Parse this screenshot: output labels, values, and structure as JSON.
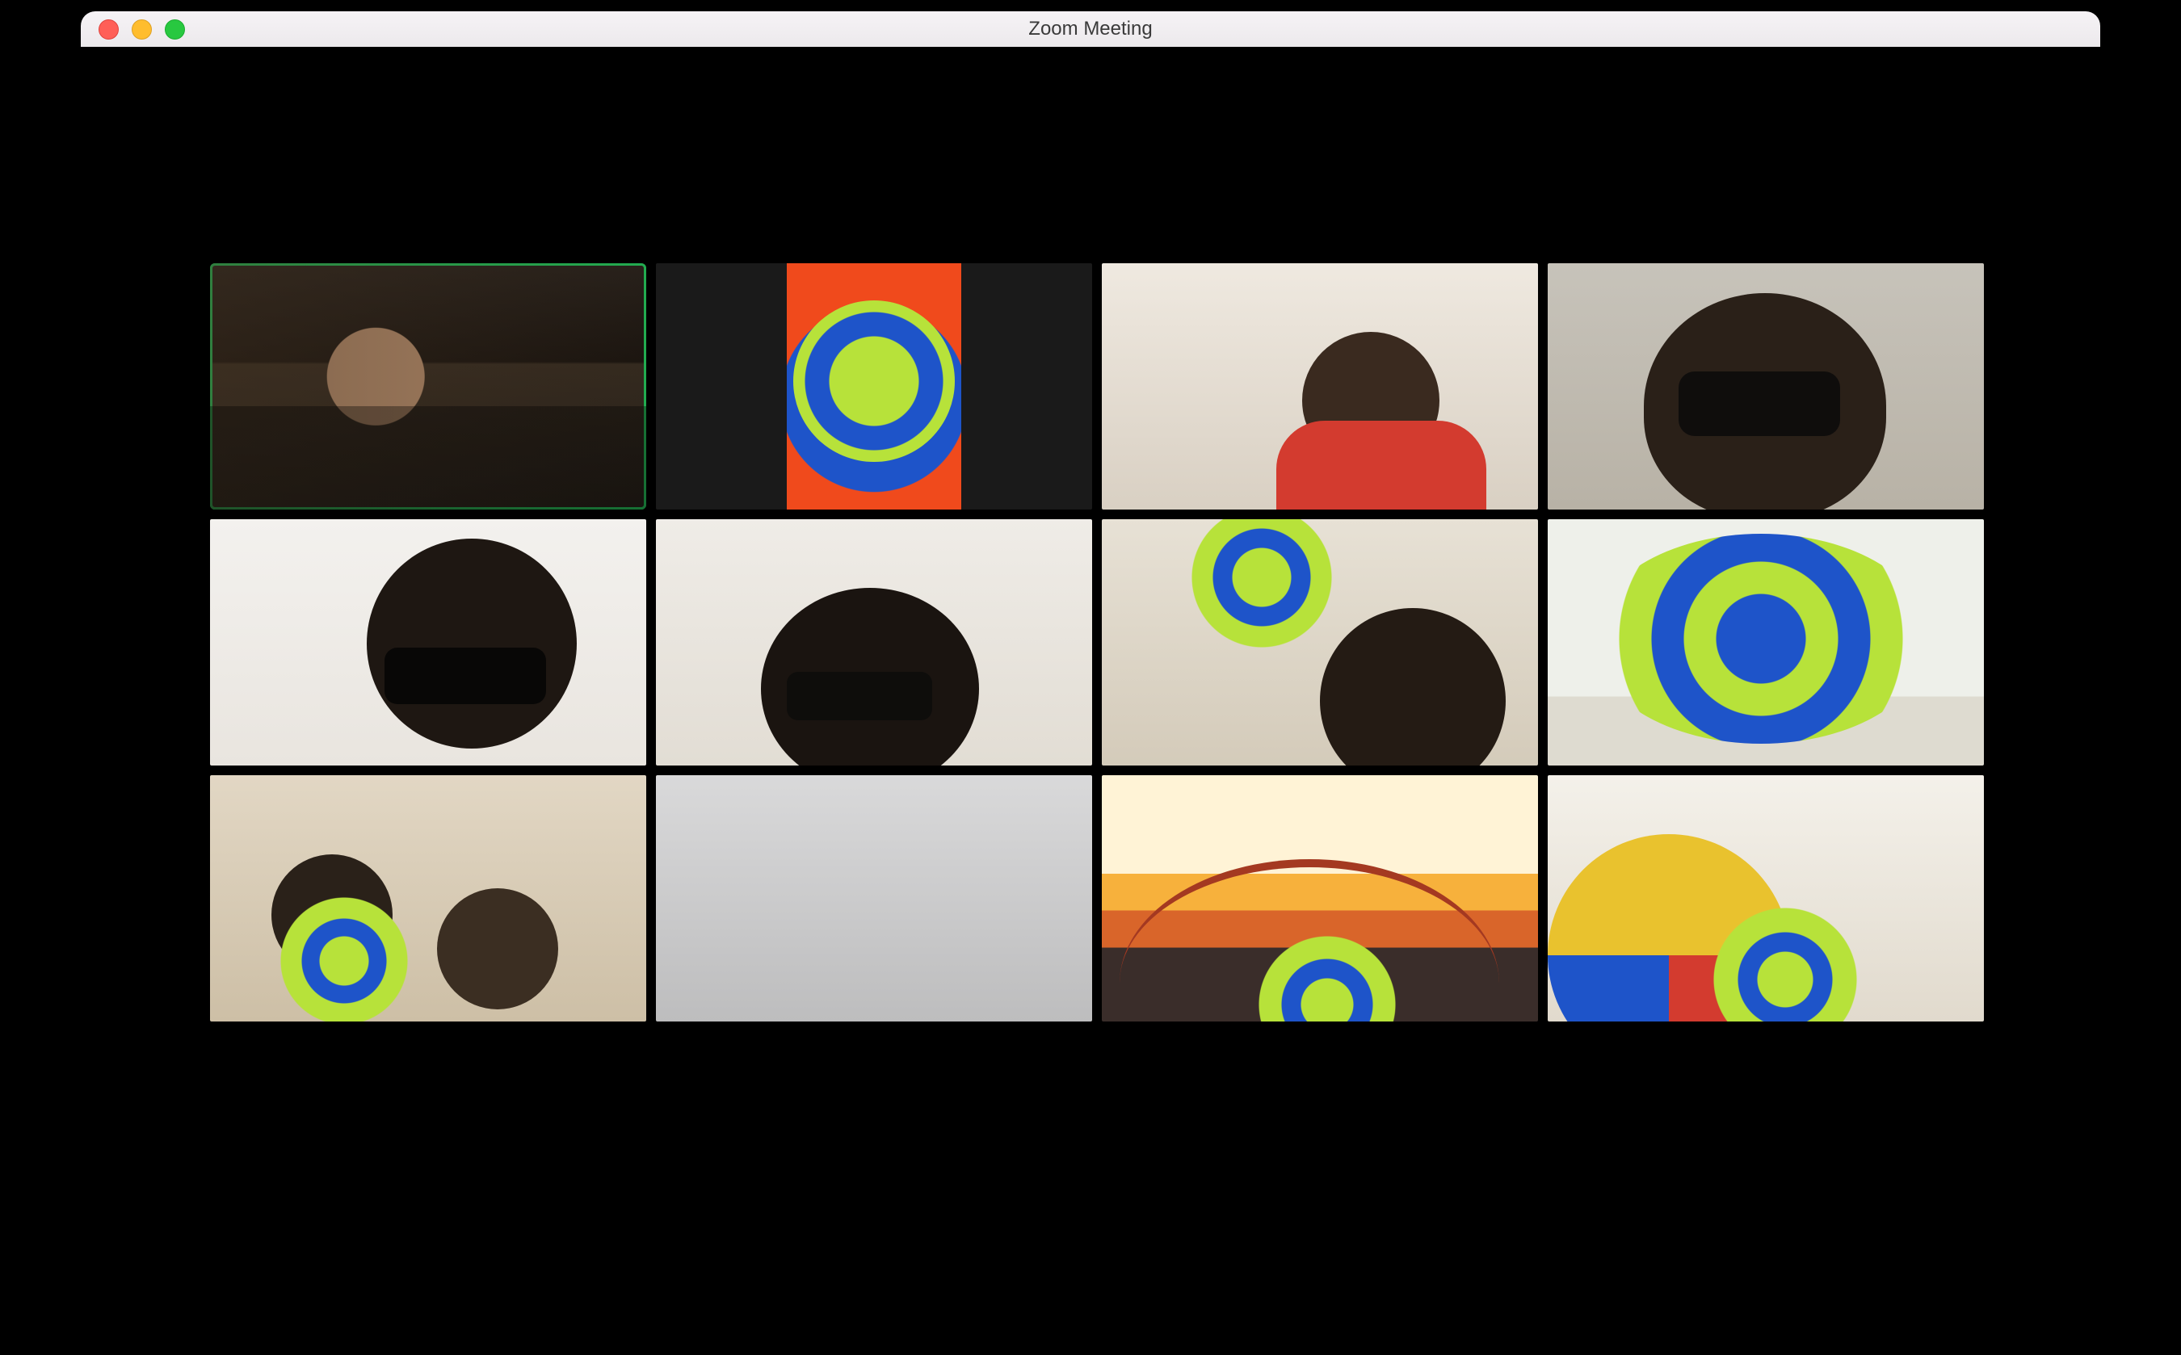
{
  "window": {
    "title": "Zoom Meeting"
  },
  "grid": {
    "columns": 4,
    "rows": 3,
    "activeSpeakerIndex": 0,
    "tiles": [
      {
        "desc": "participant-1-speaking",
        "speaking": true
      },
      {
        "desc": "participant-2"
      },
      {
        "desc": "participant-3"
      },
      {
        "desc": "participant-4"
      },
      {
        "desc": "participant-5"
      },
      {
        "desc": "participant-6"
      },
      {
        "desc": "participant-7"
      },
      {
        "desc": "participant-8"
      },
      {
        "desc": "participant-9"
      },
      {
        "desc": "participant-10"
      },
      {
        "desc": "participant-11"
      },
      {
        "desc": "participant-12"
      }
    ]
  }
}
